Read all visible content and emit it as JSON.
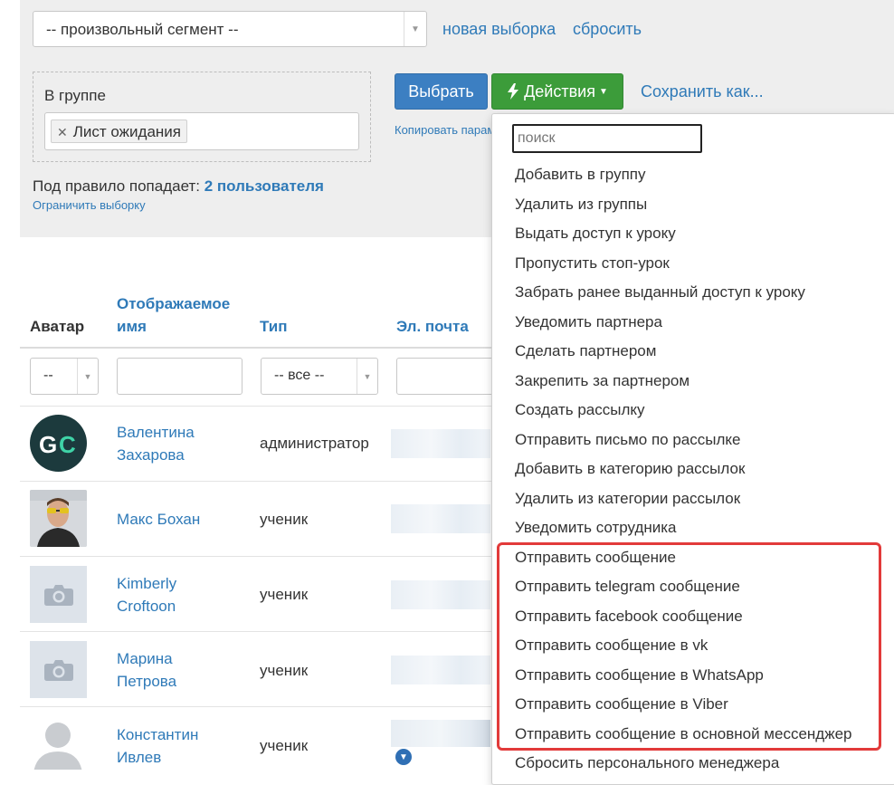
{
  "filters": {
    "segment_value": "-- произвольный сегмент --",
    "new_selection": "новая выборка",
    "reset": "сбросить"
  },
  "rule": {
    "label": "В группе",
    "tag": "Лист ожидания",
    "count_prefix": "Под правило попадает:",
    "count_value": "2 пользователя",
    "limit_link": "Ограничить выборку"
  },
  "toolbar": {
    "select_label": "Выбрать",
    "actions_label": "Действия",
    "save_as_label": "Сохранить как...",
    "copy_params_label": "Копировать параметры"
  },
  "dropdown": {
    "search_placeholder": "поиск",
    "items": [
      "Добавить в группу",
      "Удалить из группы",
      "Выдать доступ к уроку",
      "Пропустить стоп-урок",
      "Забрать ранее выданный доступ к уроку",
      "Уведомить партнера",
      "Сделать партнером",
      "Закрепить за партнером",
      "Создать рассылку",
      "Отправить письмо по рассылке",
      "Добавить в категорию рассылок",
      "Удалить из категории рассылок",
      "Уведомить сотрудника",
      "Отправить сообщение",
      "Отправить telegram сообщение",
      "Отправить facebook сообщение",
      "Отправить сообщение в vk",
      "Отправить сообщение в WhatsApp",
      "Отправить сообщение в Viber",
      "Отправить сообщение в основной мессенджер",
      "Сбросить персонального менеджера"
    ]
  },
  "table": {
    "headers": {
      "avatar": "Аватар",
      "display_name_line1": "Отображаемое",
      "display_name_line2": "имя",
      "type": "Тип",
      "email": "Эл. почта"
    },
    "filters": {
      "avatar": "--",
      "type": "-- все --"
    },
    "rows": [
      {
        "name1": "Валентина",
        "name2": "Захарова",
        "type": "администратор",
        "avatar": "GC"
      },
      {
        "name1": "Макс Бохан",
        "name2": "",
        "type": "ученик",
        "avatar": "photo"
      },
      {
        "name1": "Kimberly",
        "name2": "Croftoon",
        "type": "ученик",
        "avatar": "camera"
      },
      {
        "name1": "Марина",
        "name2": "Петрова",
        "type": "ученик",
        "avatar": "camera"
      },
      {
        "name1": "Константин",
        "name2": "Ивлев",
        "type": "ученик",
        "avatar": "silhouette"
      }
    ]
  },
  "colors": {
    "link": "#2f7ab8",
    "select_button": "#3c7fc2",
    "actions_button": "#3c9c3a",
    "highlight": "#e23a3a"
  }
}
